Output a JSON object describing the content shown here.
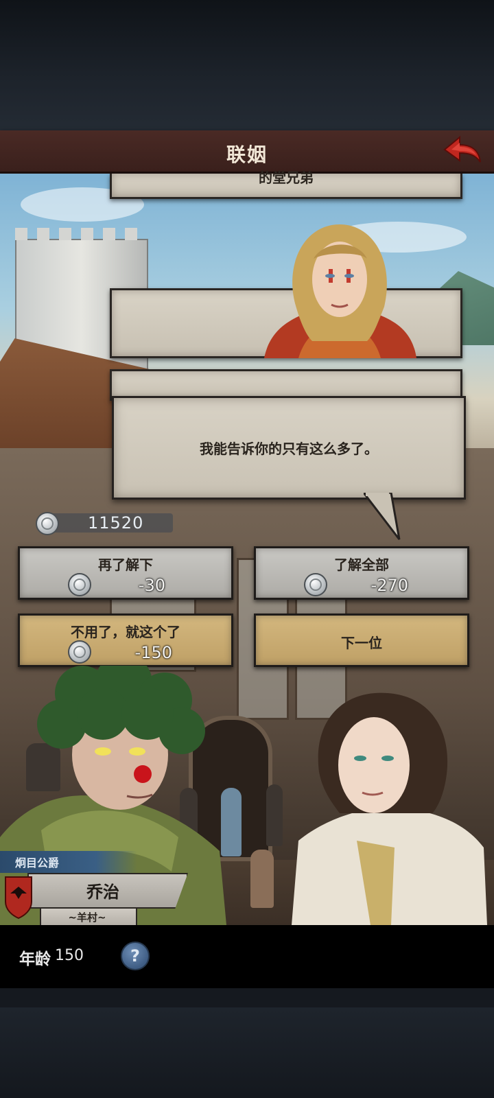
{
  "header": {
    "title": "联姻"
  },
  "dialog": {
    "partial_text": "的堂兄弟",
    "speech": "我能告诉你的只有这么多了。"
  },
  "currency": {
    "total": "11520"
  },
  "options": [
    {
      "label": "再了解下",
      "cost": "-30"
    },
    {
      "label": "了解全部",
      "cost": "-270"
    },
    {
      "label": "不用了，就这个了",
      "cost": "-150"
    },
    {
      "label": "下一位"
    }
  ],
  "character": {
    "title": "炯目公爵",
    "name": "乔治",
    "village": "~羊村~",
    "age_label": "年龄",
    "age_value": "150"
  },
  "help": {
    "symbol": "?"
  },
  "colors": {
    "header": "#4a2a25",
    "option_grey": "#c9c8c4",
    "option_gold": "#d3b77e",
    "title_ribbon": "#3a5f85",
    "shield": "#b0281f"
  },
  "icons": [
    "back-arrow-icon",
    "silver-coin-icon",
    "crow-shield-icon",
    "question-icon"
  ]
}
